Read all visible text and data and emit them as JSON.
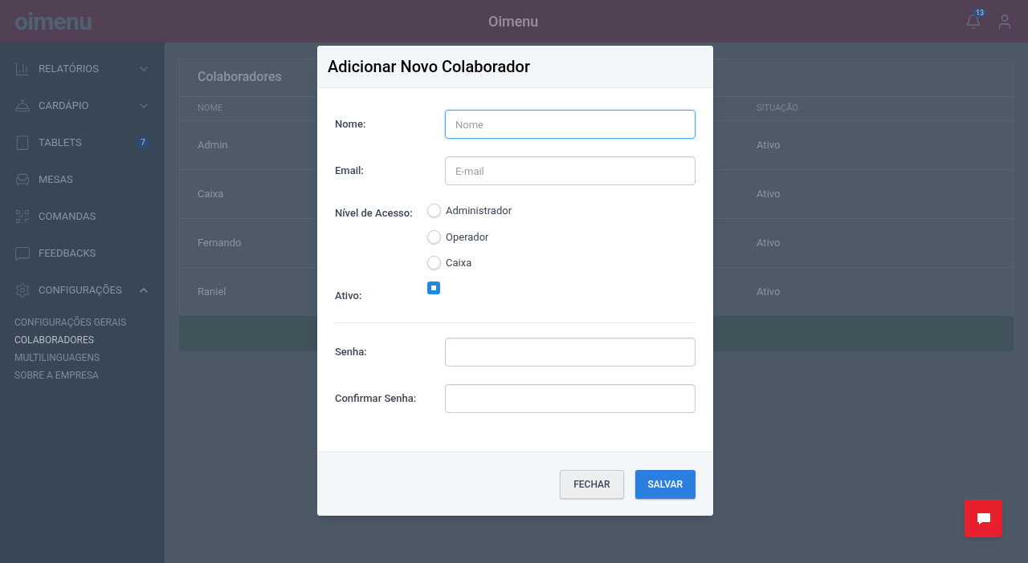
{
  "header": {
    "logo": "oimenu",
    "title": "Oimenu",
    "notifications": "13"
  },
  "sidebar": {
    "items": [
      {
        "label": "RELATÓRIOS",
        "expanded": false
      },
      {
        "label": "CARDÁPIO",
        "expanded": false
      },
      {
        "label": "TABLETS",
        "badge": "7"
      },
      {
        "label": "MESAS"
      },
      {
        "label": "COMANDAS"
      },
      {
        "label": "FEEDBACKS"
      },
      {
        "label": "CONFIGURAÇÕES",
        "expanded": true,
        "children": [
          {
            "label": "CONFIGURAÇÕES GERAIS",
            "selected": false
          },
          {
            "label": "COLABORADORES",
            "selected": true
          },
          {
            "label": "MULTILINGUAGENS",
            "selected": false
          },
          {
            "label": "SOBRE A EMPRESA",
            "selected": false
          }
        ]
      }
    ]
  },
  "page": {
    "title": "Colaboradores",
    "columns": [
      "NOME",
      "SITUAÇÃO"
    ],
    "rows": [
      [
        "Admin",
        "Ativo"
      ],
      [
        "Caixa",
        "Ativo"
      ],
      [
        "Fernando",
        "Ativo"
      ],
      [
        "Raniel",
        "Ativo"
      ]
    ]
  },
  "dialog": {
    "title": "Adicionar Novo Colaborador",
    "name": {
      "label": "Nome:",
      "placeholder": "Nome"
    },
    "email": {
      "label": "Email:",
      "placeholder": "E-mail"
    },
    "access": {
      "label": "Nível de Acesso:",
      "options": [
        {
          "label": "Administrador",
          "selected": false
        },
        {
          "label": "Operador",
          "selected": false
        },
        {
          "label": "Caixa",
          "selected": false
        }
      ]
    },
    "active": {
      "label": "Ativo:",
      "checked": true
    },
    "password": {
      "label": "Senha:"
    },
    "confirm": {
      "label": "Confirmar Senha:"
    },
    "buttons": [
      {
        "label": "FECHAR",
        "kind": "secondary"
      },
      {
        "label": "SALVAR",
        "kind": "primary"
      }
    ]
  }
}
